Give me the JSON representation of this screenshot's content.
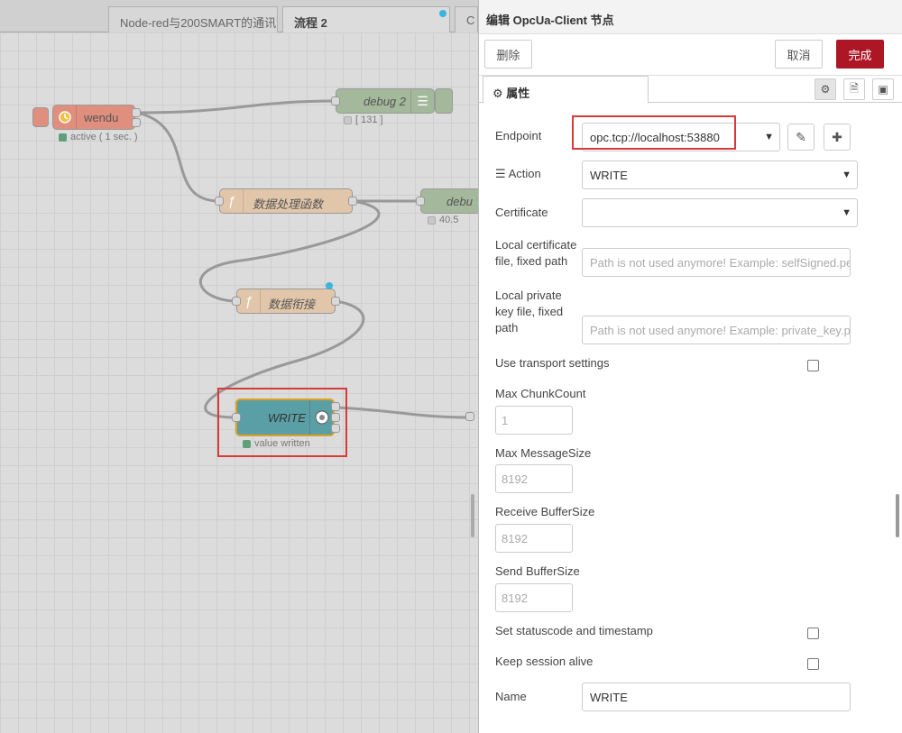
{
  "tabs": [
    {
      "label": "Node-red与200SMART的通讯"
    },
    {
      "label": "流程 2"
    },
    {
      "label": "C"
    }
  ],
  "nodes": {
    "wendu": {
      "label": "wendu",
      "status": "active ( 1 sec. )"
    },
    "debug2": {
      "label": "debug 2",
      "status": "[ 131 ]"
    },
    "func1": {
      "label": "数据处理函数"
    },
    "debug_partial": {
      "label": "debu",
      "status": "40.5"
    },
    "func2": {
      "label": "数据衔接"
    },
    "write": {
      "label": "WRITE",
      "status": "value written"
    }
  },
  "panel": {
    "title": "编辑 OpcUa-Client 节点",
    "delete_label": "删除",
    "cancel_label": "取消",
    "done_label": "完成",
    "properties_tab": "属性",
    "fields": {
      "endpoint_label": "Endpoint",
      "endpoint_value": "opc.tcp://localhost:53880",
      "action_label": "Action",
      "action_value": "WRITE",
      "certificate_label": "Certificate",
      "certificate_value": "",
      "local_cert_label_1": "Local certificate",
      "local_cert_label_2": "file, fixed path",
      "local_cert_placeholder": "Path is not used anymore! Example: selfSigned.pem",
      "local_key_label_1": "Local private",
      "local_key_label_2": "key file, fixed",
      "local_key_label_3": "path",
      "local_key_placeholder": "Path is not used anymore! Example: private_key.pem",
      "use_transport_label": "Use transport settings",
      "max_chunk_label": "Max ChunkCount",
      "max_chunk_value": "1",
      "max_msg_label": "Max MessageSize",
      "max_msg_value": "8192",
      "recv_buf_label": "Receive BufferSize",
      "recv_buf_value": "8192",
      "send_buf_label": "Send BufferSize",
      "send_buf_value": "8192",
      "set_status_label": "Set statuscode and timestamp",
      "keep_alive_label": "Keep session alive",
      "name_label": "Name",
      "name_value": "WRITE"
    }
  },
  "colors": {
    "accent_red": "#ad1625",
    "highlight_red": "#d63a3a",
    "func_node": "#e2c6aa",
    "debug_node": "#a4b89b",
    "inject_node": "#e08f7e",
    "opcua_node": "#5a9fa6"
  }
}
